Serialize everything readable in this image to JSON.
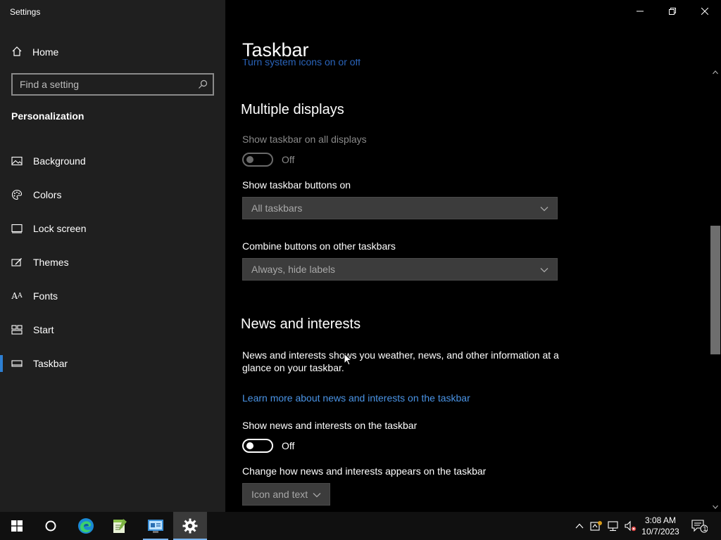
{
  "app": {
    "title": "Settings"
  },
  "sidebar": {
    "home_label": "Home",
    "search_placeholder": "Find a setting",
    "section_label": "Personalization",
    "items": [
      {
        "label": "Background",
        "icon": "picture-icon"
      },
      {
        "label": "Colors",
        "icon": "palette-icon"
      },
      {
        "label": "Lock screen",
        "icon": "lock-screen-icon"
      },
      {
        "label": "Themes",
        "icon": "themes-icon"
      },
      {
        "label": "Fonts",
        "icon": "fonts-icon"
      },
      {
        "label": "Start",
        "icon": "start-icon"
      },
      {
        "label": "Taskbar",
        "icon": "taskbar-icon",
        "active": true
      }
    ]
  },
  "main": {
    "page_title": "Taskbar",
    "partial_link": "Turn system icons on or off",
    "multiple_displays": {
      "heading": "Multiple displays",
      "show_on_all_label": "Show taskbar on all displays",
      "show_on_all_state": "Off",
      "buttons_on_label": "Show taskbar buttons on",
      "buttons_on_value": "All taskbars",
      "combine_label": "Combine buttons on other taskbars",
      "combine_value": "Always, hide labels"
    },
    "news": {
      "heading": "News and interests",
      "description": "News and interests shows you weather, news, and other information at a glance on your taskbar.",
      "learn_more": "Learn more about news and interests on the taskbar",
      "show_label": "Show news and interests on the taskbar",
      "show_state": "Off",
      "appearance_label": "Change how news and interests appears on the taskbar",
      "appearance_value": "Icon and text"
    }
  },
  "taskbar": {
    "time": "3:08 AM",
    "date": "10/7/2023",
    "notification_count": "1",
    "accent": "#7ab4ee"
  },
  "colors": {
    "accent": "#2d7fd2",
    "link": "#4a94e6",
    "sidebar_bg": "#1f1f1f"
  }
}
